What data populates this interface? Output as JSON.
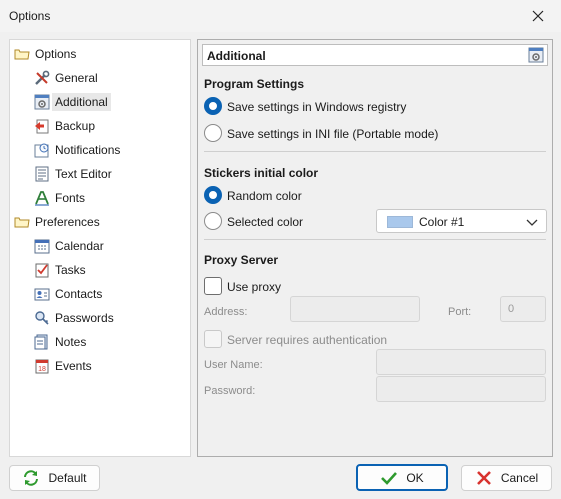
{
  "window": {
    "title": "Options"
  },
  "tree": [
    {
      "label": "Options",
      "icon": "folder-icon"
    },
    {
      "label": "General",
      "icon": "tools-icon"
    },
    {
      "label": "Additional",
      "icon": "additional-settings-icon"
    },
    {
      "label": "Backup",
      "icon": "backup-icon"
    },
    {
      "label": "Notifications",
      "icon": "notifications-icon"
    },
    {
      "label": "Text Editor",
      "icon": "text-editor-icon"
    },
    {
      "label": "Fonts",
      "icon": "fonts-icon"
    },
    {
      "label": "Preferences",
      "icon": "folder-icon"
    },
    {
      "label": "Calendar",
      "icon": "calendar-icon"
    },
    {
      "label": "Tasks",
      "icon": "tasks-icon"
    },
    {
      "label": "Contacts",
      "icon": "contacts-icon"
    },
    {
      "label": "Passwords",
      "icon": "passwords-icon"
    },
    {
      "label": "Notes",
      "icon": "notes-icon"
    },
    {
      "label": "Events",
      "icon": "events-icon"
    }
  ],
  "panel": {
    "title": "Additional",
    "program_settings": {
      "heading": "Program Settings",
      "option_registry": "Save settings in Windows registry",
      "option_ini": "Save settings in INI file (Portable mode)",
      "selected": "registry"
    },
    "stickers": {
      "heading": "Stickers initial color",
      "option_random": "Random color",
      "option_selected": "Selected color",
      "selected": "random",
      "color_value": "Color #1",
      "color_swatch": "#a9c8ec"
    },
    "proxy": {
      "heading": "Proxy Server",
      "use_proxy": "Use proxy",
      "address_label": "Address:",
      "port_label": "Port:",
      "port_value": "0",
      "auth_label": "Server requires authentication",
      "username_label": "User Name:",
      "password_label": "Password:"
    }
  },
  "buttons": {
    "default": "Default",
    "ok": "OK",
    "cancel": "Cancel"
  },
  "colors": {
    "accent": "#0a62b3",
    "ok_check": "#2e9a2e",
    "cancel_x": "#d8322e"
  }
}
